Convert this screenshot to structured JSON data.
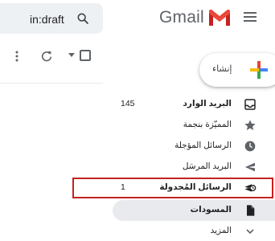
{
  "header": {
    "search_query": "in:draft",
    "app_name": "Gmail"
  },
  "compose": {
    "label": "إنشاء"
  },
  "nav": {
    "items": [
      {
        "label": "البريد الوارد",
        "count": "145",
        "icon": "inbox-icon",
        "bold": true
      },
      {
        "label": "المميّزة بنجمة",
        "count": "",
        "icon": "star-icon",
        "bold": false
      },
      {
        "label": "الرسائل المؤجلة",
        "count": "",
        "icon": "clock-icon",
        "bold": false
      },
      {
        "label": "البريد المرسَل",
        "count": "",
        "icon": "send-icon",
        "bold": false
      },
      {
        "label": "الرسائل المُجدولة",
        "count": "1",
        "icon": "scheduled-send-icon",
        "bold": true,
        "highlighted": true
      },
      {
        "label": "المسودات",
        "count": "",
        "icon": "draft-icon",
        "bold": true,
        "active": true
      },
      {
        "label": "المزيد",
        "count": "",
        "icon": "chevron-down-icon",
        "bold": false
      }
    ]
  },
  "colors": {
    "gmail_red": "#ea4335",
    "highlight_border": "#c5221f",
    "active_bg": "#e8eaed",
    "icon_gray": "#5f6368"
  }
}
